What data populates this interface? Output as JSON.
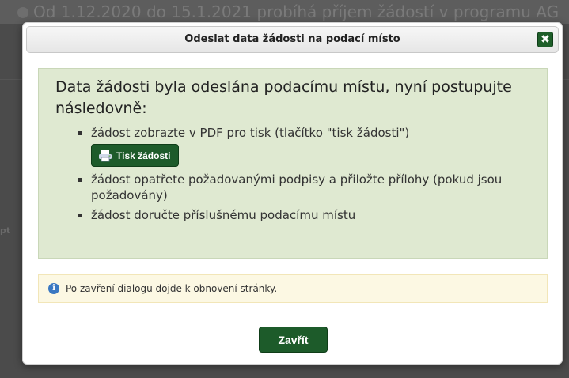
{
  "background": {
    "banner_text": "Od 1.12.2020 do 15.1.2021 probíhá příjem žádostí v programu AG",
    "side_text": "pt"
  },
  "dialog": {
    "title": "Odeslat data žádosti na podací místo",
    "close_icon": "✖",
    "heading": "Data žádosti byla odeslána podacímu místu, nyní postupujte následovně:",
    "steps": [
      "žádost zobrazte v PDF pro tisk (tlačítko \"tisk žádosti\")",
      "žádost opatřete požadovanými podpisy a přiložte přílohy (pokud jsou požadovány)",
      "žádost doručte příslušnému podacímu místu"
    ],
    "print_button_label": "Tisk žádosti",
    "notice_icon": "i",
    "notice": "Po zavření dialogu dojde k obnovení stránky.",
    "close_button_label": "Zavřít"
  },
  "colors": {
    "accent_green": "#1d5b2a",
    "panel_green": "#dfe9d1",
    "notice_yellow": "#fcf8e3",
    "info_blue": "#3a78c2"
  }
}
